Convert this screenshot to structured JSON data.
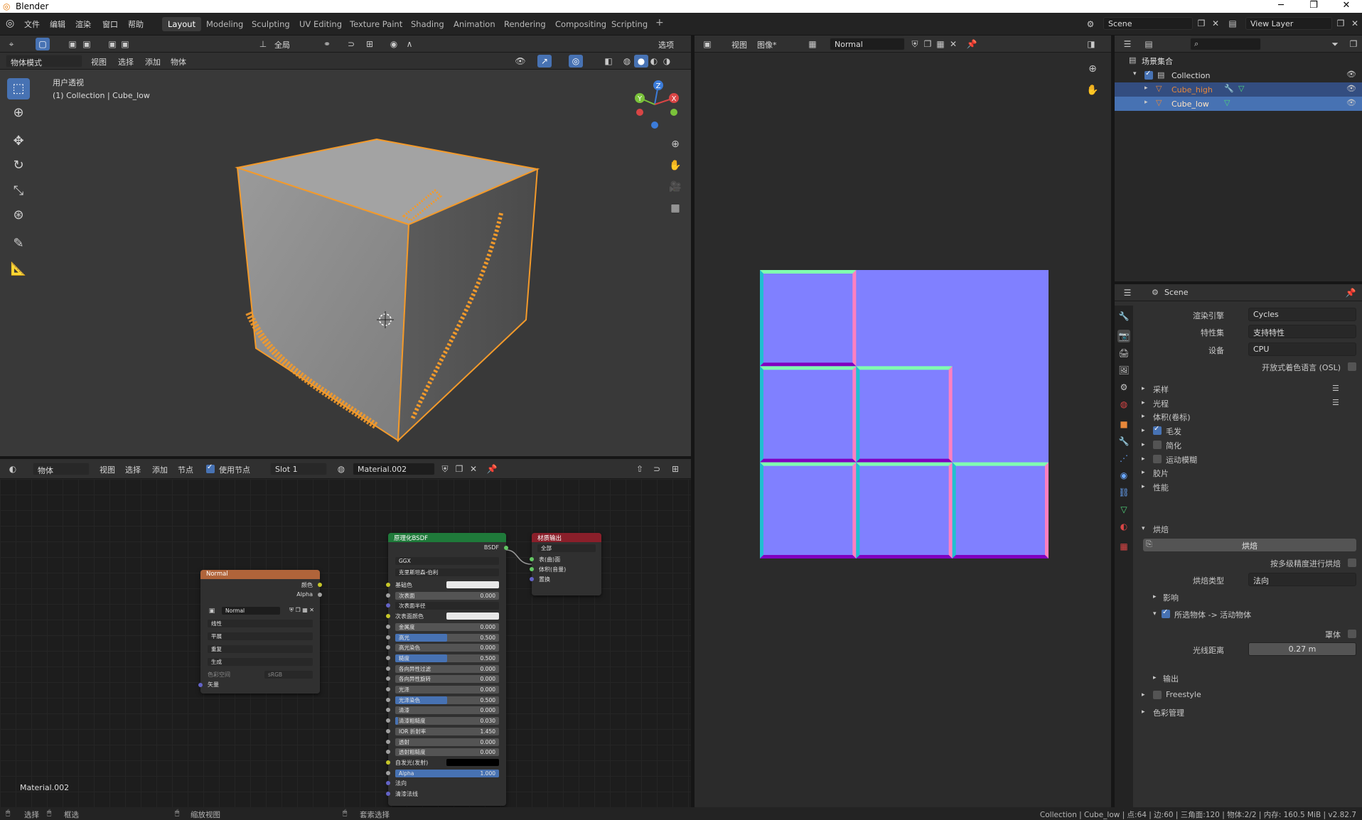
{
  "app": {
    "title": "Blender"
  },
  "menubar": {
    "items": [
      "文件",
      "编辑",
      "渲染",
      "窗口",
      "帮助"
    ]
  },
  "workspaces": {
    "tabs": [
      "Layout",
      "Modeling",
      "Sculpting",
      "UV Editing",
      "Texture Paint",
      "Shading",
      "Animation",
      "Rendering",
      "Compositing",
      "Scripting"
    ],
    "active": "Layout"
  },
  "scene": {
    "name": "Scene",
    "view_layer": "View Layer"
  },
  "viewport": {
    "mode": "物体模式",
    "menus": [
      "视图",
      "选择",
      "添加",
      "物体"
    ],
    "transform_orientation": "全局",
    "options": "选项",
    "overlay_title": "用户透视",
    "overlay_subtitle": "(1) Collection | Cube_low",
    "gizmo": {
      "z": "Z",
      "y": "Y",
      "x": "X"
    }
  },
  "node_editor": {
    "type": "物体",
    "menus": [
      "视图",
      "选择",
      "添加",
      "节点"
    ],
    "use_nodes_label": "使用节点",
    "use_nodes": true,
    "slot": "Slot 1",
    "material": "Material.002",
    "footer_label": "Material.002"
  },
  "nodes": {
    "normal_tex": {
      "title": "Normal",
      "outputs": [
        "颜色",
        "Alpha"
      ],
      "image": "Normal",
      "fields": [
        "线性",
        "平展",
        "重复",
        "生成"
      ],
      "colorspace_label": "色彩空间",
      "colorspace_value": "sRGB",
      "input": "矢量",
      "color": "#b0643a"
    },
    "bsdf": {
      "title": "原理化BSDF",
      "output": "BSDF",
      "dist": "GGX",
      "sss_method": "克里斯坦森-伯利",
      "color": "#1f7a3a",
      "rows": [
        {
          "label": "基础色",
          "type": "color",
          "value": "#e8e8e8"
        },
        {
          "label": "次表面",
          "value": "0.000"
        },
        {
          "label": "次表面半径",
          "type": "dropdown"
        },
        {
          "label": "次表面颜色",
          "type": "color",
          "value": "#e8e8e8"
        },
        {
          "label": "金属度",
          "value": "0.000"
        },
        {
          "label": "高光",
          "value": "0.500",
          "fill": 0.5
        },
        {
          "label": "高光染色",
          "value": "0.000"
        },
        {
          "label": "糙度",
          "value": "0.500",
          "fill": 0.5
        },
        {
          "label": "各向异性过滤",
          "value": "0.000"
        },
        {
          "label": "各向异性旋转",
          "value": "0.000"
        },
        {
          "label": "光泽",
          "value": "0.000"
        },
        {
          "label": "光泽染色",
          "value": "0.500",
          "fill": 0.5
        },
        {
          "label": "清漆",
          "value": "0.000"
        },
        {
          "label": "清漆粗糙度",
          "value": "0.030",
          "fill": 0.03
        },
        {
          "label": "IOR 折射率",
          "value": "1.450"
        },
        {
          "label": "透射",
          "value": "0.000"
        },
        {
          "label": "透射粗糙度",
          "value": "0.000"
        },
        {
          "label": "自发光(发射)",
          "type": "color",
          "value": "#000000"
        },
        {
          "label": "Alpha",
          "value": "1.000",
          "fill": 1.0
        },
        {
          "label": "法向",
          "type": "socket"
        },
        {
          "label": "清漆法线",
          "type": "socket"
        }
      ]
    },
    "output": {
      "title": "材质输出",
      "target": "全部",
      "inputs": [
        "表(曲)面",
        "体积(音量)",
        "置换"
      ],
      "color": "#8a1f2a"
    }
  },
  "image_editor": {
    "menus": [
      "视图",
      "图像*"
    ],
    "image": "Normal",
    "colors": {
      "base": "#8080ff",
      "top": "#80ffb0",
      "left": "#20c0d0",
      "right": "#ff80c0",
      "bottom": "#8000c0"
    }
  },
  "outliner": {
    "root": "场景集合",
    "collection": "Collection",
    "objects": [
      {
        "name": "Cube_high",
        "selected": true,
        "color": "#e8883a"
      },
      {
        "name": "Cube_low",
        "selected": true,
        "color": "#e8883a"
      }
    ]
  },
  "properties": {
    "context": "Scene",
    "render_engine_label": "渲染引擎",
    "render_engine": "Cycles",
    "feature_set_label": "特性集",
    "feature_set": "支持特性",
    "device_label": "设备",
    "device": "CPU",
    "osl_label": "开放式着色语言 (OSL)",
    "panels": [
      {
        "label": "采样",
        "list": true
      },
      {
        "label": "光程",
        "list": true
      },
      {
        "label": "体积(卷标)"
      },
      {
        "label": "毛发",
        "checkbox": true,
        "on": true
      },
      {
        "label": "简化",
        "checkbox": true,
        "on": false
      },
      {
        "label": "运动模糊",
        "checkbox": true,
        "on": false
      },
      {
        "label": "胶片"
      },
      {
        "label": "性能"
      }
    ],
    "bake": {
      "label": "烘焙",
      "button": "烘焙",
      "multires_label": "按多级精度进行烘焙",
      "type_label": "烘焙类型",
      "type_value": "法向",
      "influence": "影响",
      "selected_to_active": "所选物体 -> 活动物体",
      "cage_label": "罩体",
      "extrusion_label": "光线距离",
      "extrusion_value": "0.27 m",
      "output": "输出"
    },
    "freestyle": "Freestyle",
    "color_mgmt": "色彩管理"
  },
  "statusbar": {
    "select": "选择",
    "box_select": "框选",
    "zoom_view": "缩放视图",
    "lasso": "套索选择",
    "stats": "Collection | Cube_low | 点:64 | 边:60 | 三角面:120 | 物体:2/2 | 内存: 160.5 MiB | v2.82.7"
  }
}
